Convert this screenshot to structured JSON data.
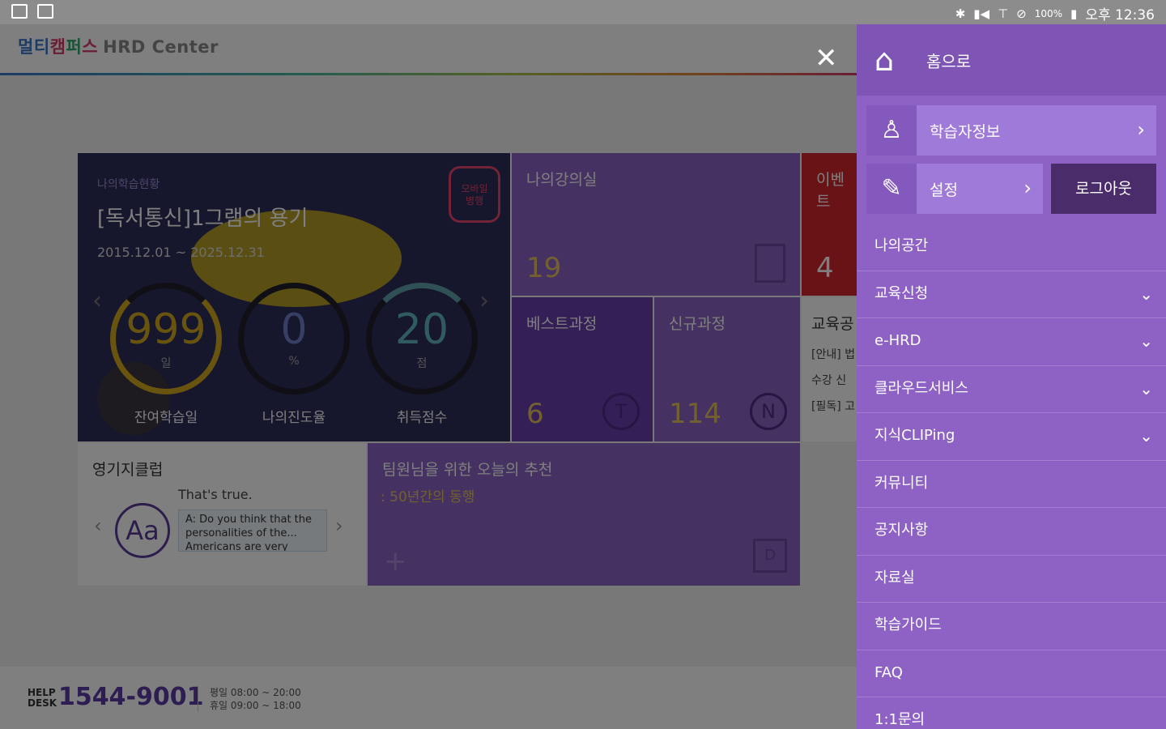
{
  "status": {
    "bluetooth": "✱",
    "signal": "▮◀",
    "wifi": "⊤",
    "mute": "⊘",
    "battery": "100%",
    "battery_icon": "▮",
    "time": "오후 12:36"
  },
  "header": {
    "logo_parts": [
      "멀티",
      "캠",
      "퍼",
      "스"
    ],
    "logo_suffix": "HRD Center",
    "close": "✕"
  },
  "study": {
    "small_label": "나의학습현황",
    "title": "[독서통신]1그램의 용기",
    "period": "2015.12.01 ~ 2025.12.31",
    "badge": "모바일\n병행",
    "prev": "‹",
    "next": "›",
    "gauges": [
      {
        "value": "999",
        "unit": "일",
        "label": "잔여학습일"
      },
      {
        "value": "0",
        "unit": "%",
        "label": "나의진도율"
      },
      {
        "value": "20",
        "unit": "점",
        "label": "취득점수"
      }
    ]
  },
  "tiles": {
    "class_label": "나의강의실",
    "class_count": "19",
    "event_label": "이벤트",
    "event_count": "4",
    "best_label": "베스트과정",
    "best_count": "6",
    "best_icon": "T",
    "new_label": "신규과정",
    "new_count": "114",
    "new_icon": "N",
    "edu_label": "교육공",
    "edu_lines": [
      "[안내] 법",
      "수강 신",
      "[필독] 고"
    ],
    "eng_label": "영기지클럽",
    "eng_quote": "That's true.",
    "eng_icon": "Aa",
    "eng_bubble": "A: Do you think that the personalities of the... Americans are very",
    "rec_label": "팀원님을 위한 오늘의 추천",
    "rec_sub": ": 50년간의 동행",
    "rec_plus": "+",
    "rec_icon": "D"
  },
  "footer": {
    "help": "HELP\nDESK",
    "phone": "1544-9001",
    "weekday": "평일 08:00 ~ 20:00",
    "holiday": "휴일 09:00 ~ 18:00"
  },
  "menu": {
    "home_icon": "⌂",
    "home": "홈으로",
    "learner_icon": "♙",
    "learner": "학습자정보",
    "setting_icon": "✎",
    "setting": "설정",
    "logout": "로그아웃",
    "chev_right": "›",
    "chev_down": "⌄",
    "items": [
      {
        "label": "나의공간",
        "expandable": false
      },
      {
        "label": "교육신청",
        "expandable": true
      },
      {
        "label": "e-HRD",
        "expandable": true
      },
      {
        "label": "클라우드서비스",
        "expandable": true
      },
      {
        "label": "지식CLIPing",
        "expandable": true
      },
      {
        "label": "커뮤니티",
        "expandable": false
      },
      {
        "label": "공지사항",
        "expandable": false
      },
      {
        "label": "자료실",
        "expandable": false
      },
      {
        "label": "학습가이드",
        "expandable": false
      },
      {
        "label": "FAQ",
        "expandable": false
      },
      {
        "label": "1:1문의",
        "expandable": false
      }
    ]
  },
  "colors": {
    "menu_bg": "#8e62c4",
    "accent": "#5b3aa4",
    "event": "#d2262f"
  }
}
